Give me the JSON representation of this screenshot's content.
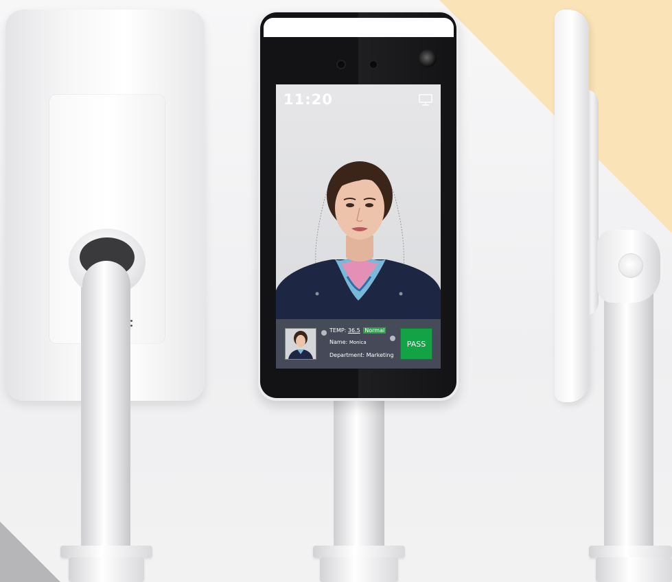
{
  "screen": {
    "clock": "11:20",
    "monitor_icon": "monitor-icon",
    "panel": {
      "temp_label": "TEMP:",
      "temp_value": "36.5",
      "temp_status": "Normal",
      "name_label": "Name:",
      "name_value": "Monica",
      "department_label": "Department:",
      "department_value": "Marketing",
      "pass_label": "PASS"
    }
  },
  "colors": {
    "pass_green": "#14a246",
    "status_green": "#2aa04a",
    "peach_accent": "#fbe3b8",
    "grey_accent": "#b6b6b8"
  }
}
